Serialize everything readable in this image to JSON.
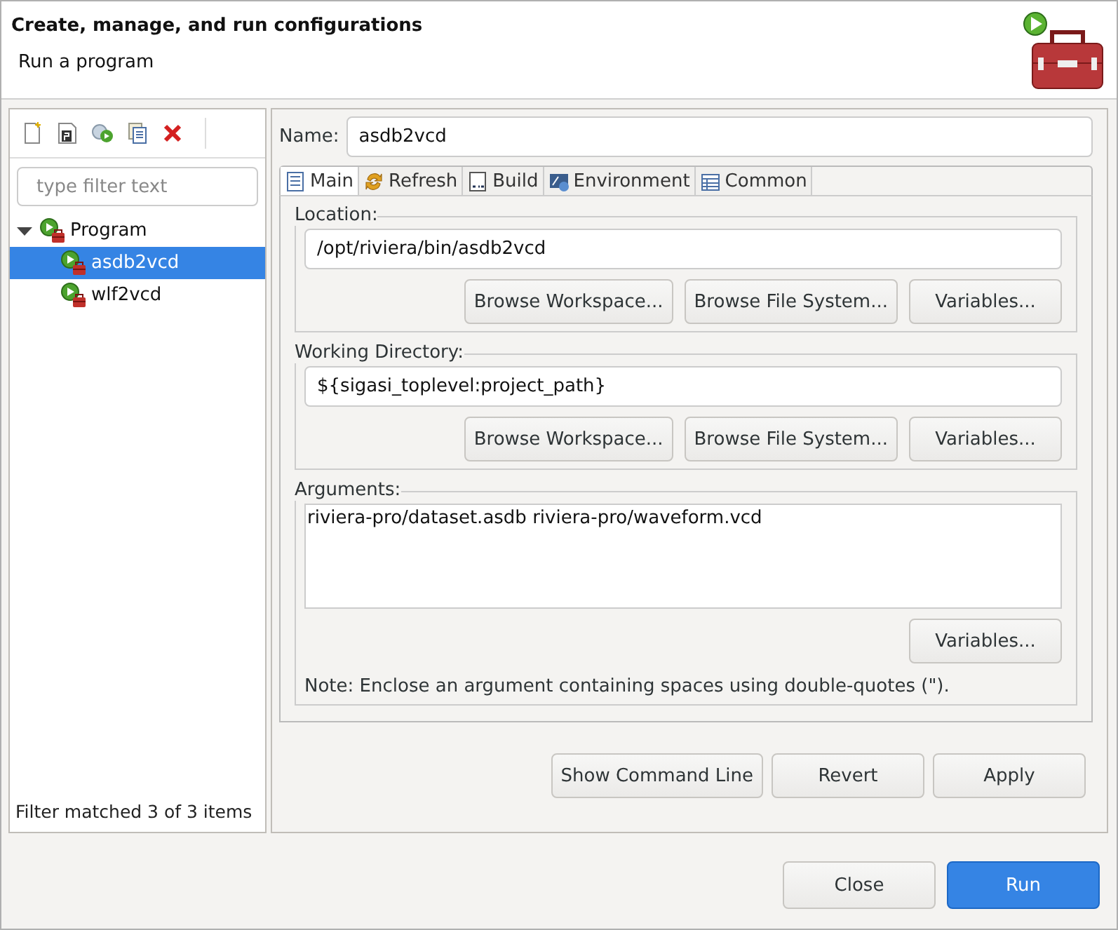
{
  "header": {
    "title": "Create, manage, and run configurations",
    "subtitle": "Run a program"
  },
  "sidebar": {
    "filter": {
      "placeholder": "type filter text"
    },
    "tree": [
      {
        "label": "Program",
        "expanded": true,
        "selected": false,
        "children": [
          {
            "label": "asdb2vcd",
            "selected": true
          },
          {
            "label": "wlf2vcd",
            "selected": false
          }
        ]
      }
    ],
    "status": "Filter matched 3 of 3 items"
  },
  "editor": {
    "name_label": "Name:",
    "name": "asdb2vcd",
    "tabs": [
      {
        "label": "Main",
        "selected": true
      },
      {
        "label": "Refresh",
        "selected": false
      },
      {
        "label": "Build",
        "selected": false
      },
      {
        "label": "Environment",
        "selected": false
      },
      {
        "label": "Common",
        "selected": false
      }
    ],
    "groups": [
      {
        "kind": "field",
        "title": "Location:",
        "value": "/opt/riviera/bin/asdb2vcd",
        "buttons": [
          "Browse Workspace...",
          "Browse File System...",
          "Variables..."
        ]
      },
      {
        "kind": "field",
        "title": "Working Directory:",
        "value": "${sigasi_toplevel:project_path}",
        "buttons": [
          "Browse Workspace...",
          "Browse File System...",
          "Variables..."
        ]
      },
      {
        "kind": "area",
        "title": "Arguments:",
        "value": "riviera-pro/dataset.asdb riviera-pro/waveform.vcd",
        "buttons": [
          "Variables..."
        ],
        "note": "Note: Enclose an argument containing spaces using double-quotes (\")."
      }
    ],
    "actions": [
      "Show Command Line",
      "Revert",
      "Apply"
    ]
  },
  "footer": [
    {
      "label": "Close",
      "default": false
    },
    {
      "label": "Run",
      "default": true
    }
  ]
}
